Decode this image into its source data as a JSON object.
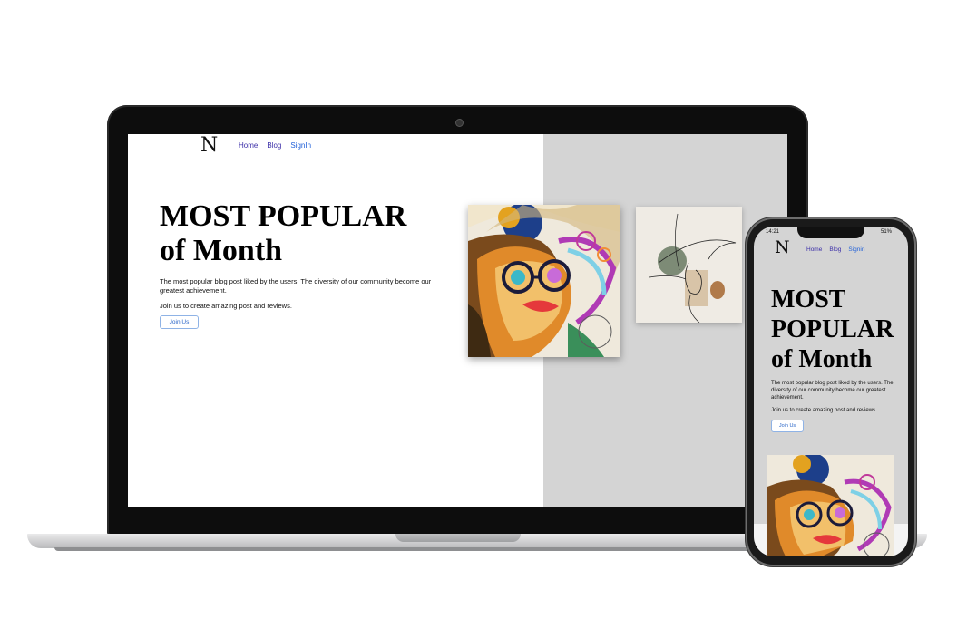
{
  "laptop": {
    "logo": "N",
    "nav": {
      "home": "Home",
      "blog": "Blog",
      "signin": "SignIn"
    },
    "hero": {
      "title_line1": "MOST POPULAR",
      "title_line2": "of Month",
      "desc1": "The most popular blog post liked by the users. The diversity of our community become our greatest achievement.",
      "desc2": "Join us to create amazing post and reviews.",
      "button": "Join Us"
    }
  },
  "phone": {
    "status": {
      "time": "14:21",
      "battery": "51%"
    },
    "logo": "N",
    "nav": {
      "home": "Home",
      "blog": "Blog",
      "signin": "Signin"
    },
    "hero": {
      "title_line1": "MOST",
      "title_line2": "POPULAR",
      "title_line3": "of Month",
      "desc1": "The most popular blog post liked by the users. The diversity of our community become our greatest achievement.",
      "desc2": "Join us to create amazing post and reviews.",
      "button": "Join Us"
    }
  },
  "colors": {
    "nav_link": "#3b2ea8",
    "signin_link": "#1f5fd8",
    "button_border": "#8fb3e6",
    "right_panel": "#d4d4d4"
  },
  "icons": [
    "logo-n-icon",
    "camera-icon"
  ]
}
